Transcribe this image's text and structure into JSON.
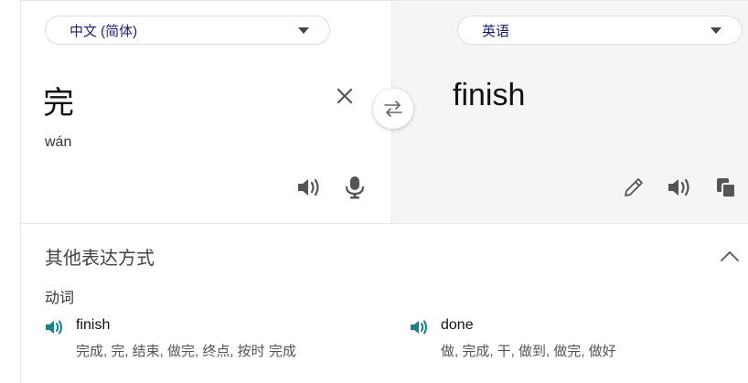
{
  "source": {
    "language": "中文 (简体)",
    "text": "完",
    "romanization": "wán"
  },
  "target": {
    "language": "英语",
    "text": "finish"
  },
  "icons": {
    "clear": "close-icon",
    "swap": "swap-arrows-icon",
    "listen": "speaker-icon",
    "mic": "microphone-icon",
    "edit": "pencil-icon",
    "copy": "copy-icon",
    "collapse": "chevron-up-icon"
  },
  "colors": {
    "language_text": "#1a1f7a",
    "speaker_accent": "#1a7f8e",
    "target_panel_bg": "#f5f5f5"
  },
  "more_translations": {
    "title": "其他表达方式",
    "part_of_speech": "动词",
    "items": [
      {
        "word": "finish",
        "back_translations": "完成, 完, 结束, 做完, 终点, 按时 完成"
      },
      {
        "word": "done",
        "back_translations": "做, 完成, 干, 做到, 做完, 做好"
      }
    ]
  }
}
